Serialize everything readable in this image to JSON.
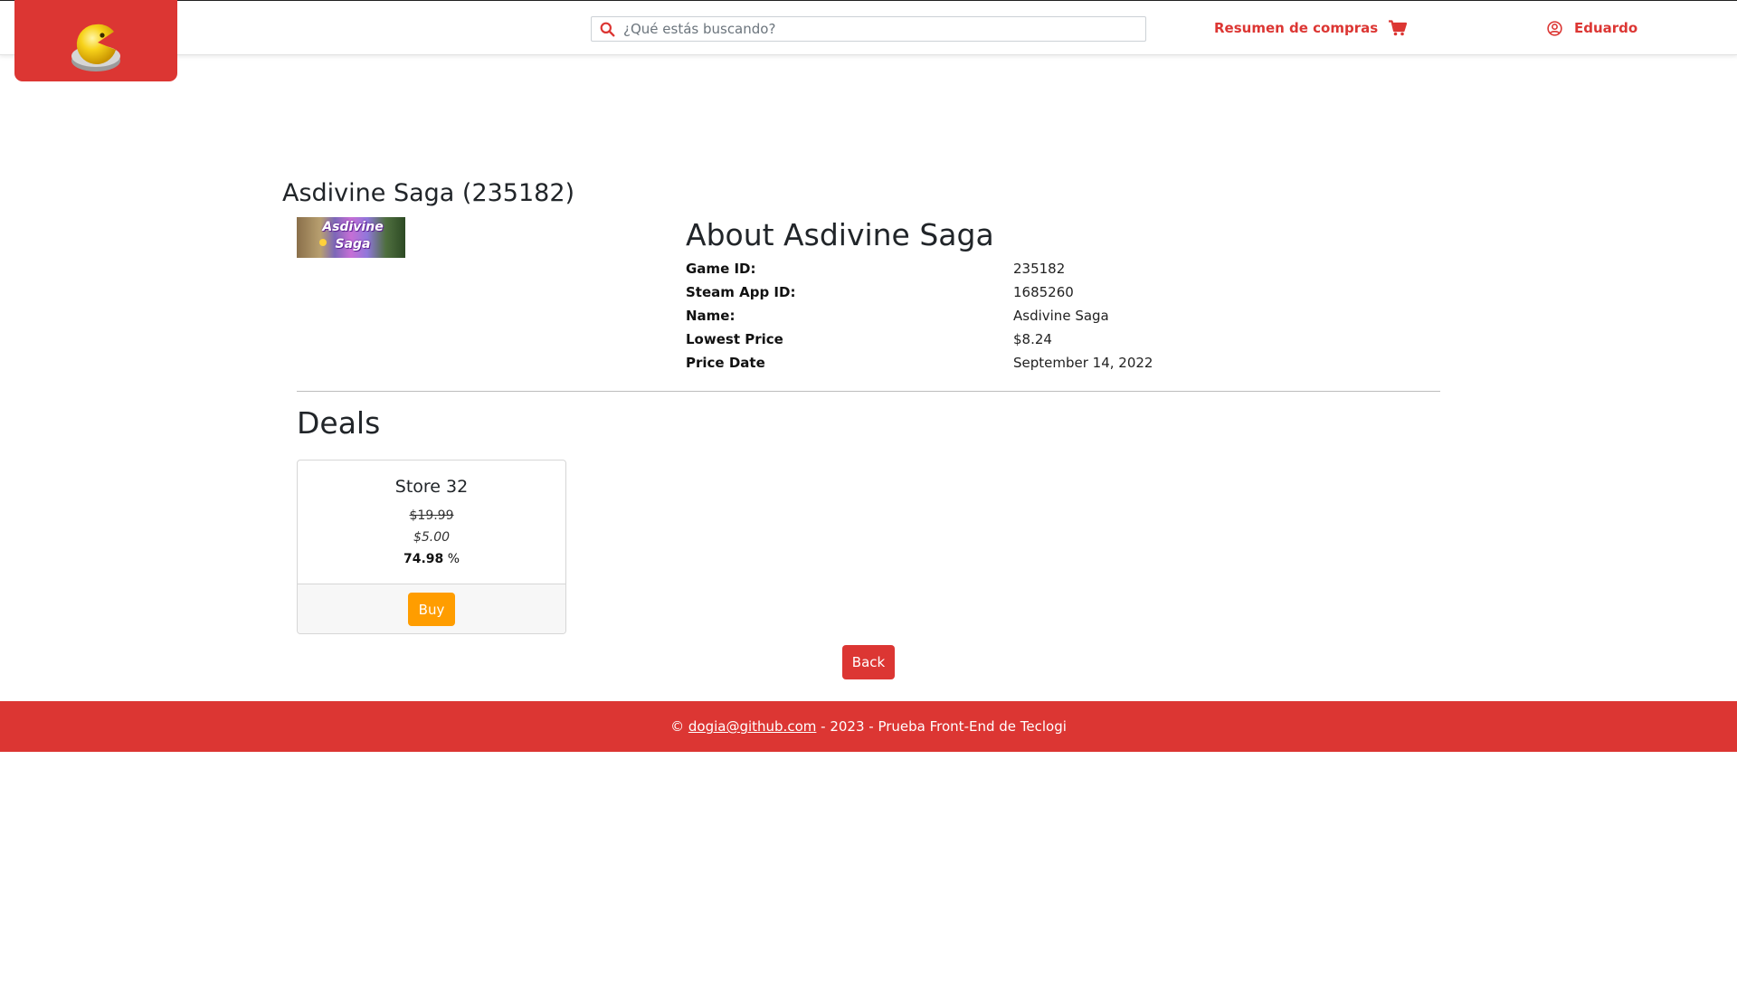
{
  "header": {
    "search_placeholder": "¿Qué estás buscando?",
    "cart_label": "Resumen de compras",
    "user_name": "Eduardo",
    "brand_color": "#dc3633"
  },
  "game": {
    "title": "Asdivine Saga (235182)",
    "thumbnail_text": "Asdivine Saga",
    "about_title": "About Asdivine Saga",
    "details": [
      {
        "label": "Game ID:",
        "value": "235182"
      },
      {
        "label": "Steam App ID:",
        "value": "1685260"
      },
      {
        "label": "Name:",
        "value": "Asdivine Saga"
      },
      {
        "label": "Lowest Price",
        "value": "$8.24"
      },
      {
        "label": "Price Date",
        "value": "September 14, 2022"
      }
    ]
  },
  "deals": {
    "title": "Deals",
    "items": [
      {
        "store": "Store 32",
        "normal_price": "$19.99",
        "sale_price": "$5.00",
        "savings_value": "74.98",
        "savings_unit": "%",
        "buy_label": "Buy"
      }
    ],
    "buy_color": "#ff9d00"
  },
  "actions": {
    "back_label": "Back"
  },
  "footer": {
    "copyright": "©",
    "email": "dogia@github.com",
    "suffix": "- 2023 - Prueba Front-End de Teclogi"
  }
}
